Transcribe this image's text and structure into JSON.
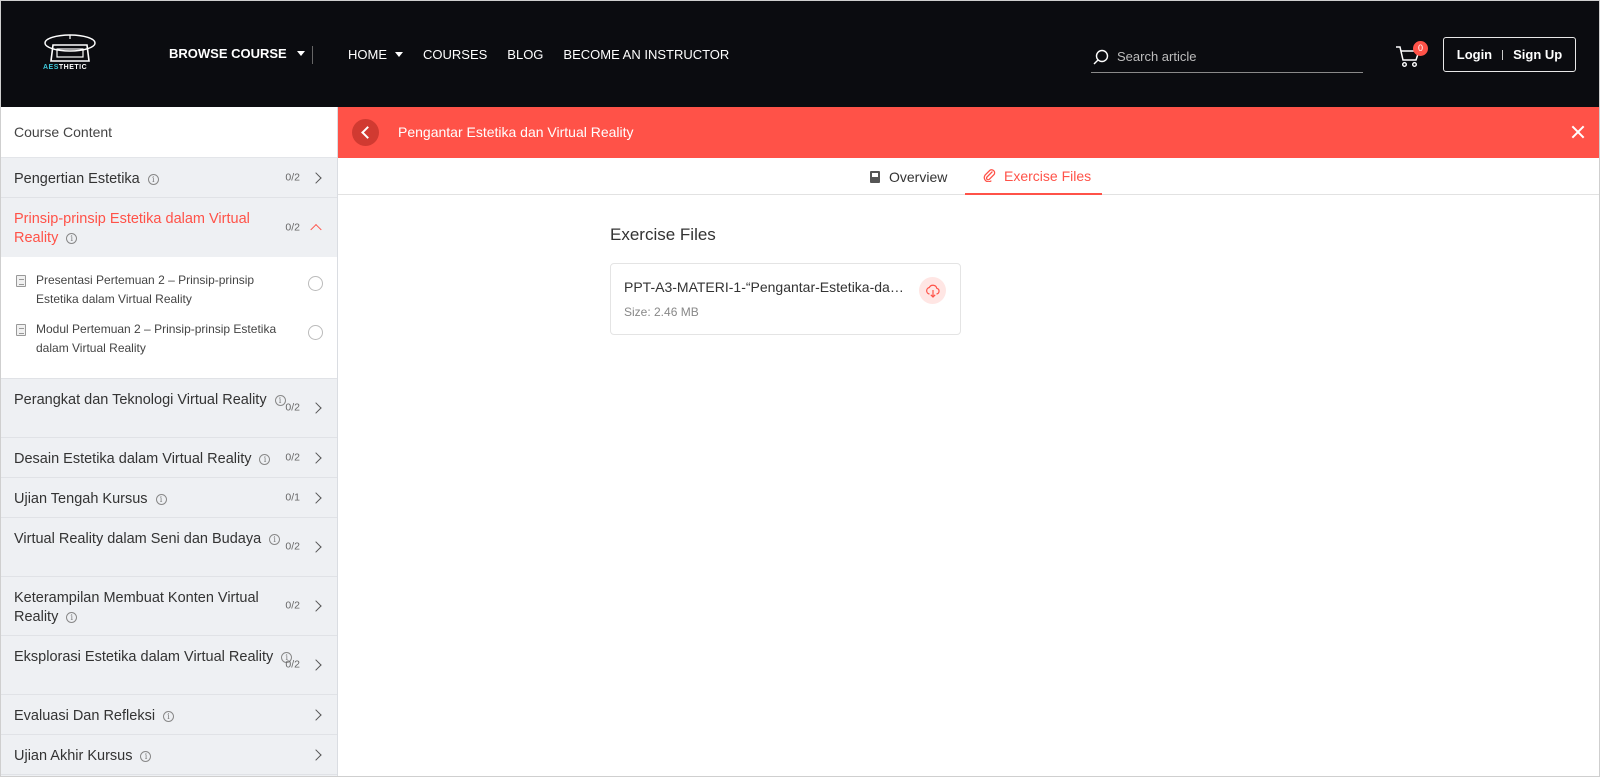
{
  "brand": {
    "name_a": "AES",
    "name_b": "THETIC"
  },
  "nav": {
    "browse_label": "BROWSE COURSE",
    "links": [
      {
        "label": "HOME"
      },
      {
        "label": "COURSES"
      },
      {
        "label": "BLOG"
      },
      {
        "label": "BECOME AN INSTRUCTOR"
      }
    ],
    "search_placeholder": "Search article",
    "cart_count": "0",
    "login_label": "Login",
    "signup_label": "Sign Up"
  },
  "sidebar": {
    "heading": "Course Content",
    "topics": [
      {
        "title": "Pengertian Estetika",
        "count": "0/2"
      },
      {
        "title": "Prinsip-prinsip Estetika dalam Virtual Reality",
        "count": "0/2",
        "expanded": true,
        "lessons": [
          {
            "title": "Presentasi Pertemuan 2 – Prinsip-prinsip Estetika dalam Virtual Reality"
          },
          {
            "title": "Modul Pertemuan 2 – Prinsip-prinsip Estetika dalam Virtual Reality"
          }
        ]
      },
      {
        "title": "Perangkat dan Teknologi Virtual Reality",
        "count": "0/2"
      },
      {
        "title": "Desain Estetika dalam Virtual Reality",
        "count": "0/2"
      },
      {
        "title": "Ujian Tengah Kursus",
        "count": "0/1"
      },
      {
        "title": "Virtual Reality dalam Seni dan Budaya",
        "count": "0/2"
      },
      {
        "title": "Keterampilan Membuat Konten Virtual Reality",
        "count": "0/2"
      },
      {
        "title": "Eksplorasi Estetika dalam Virtual Reality",
        "count": "0/2"
      },
      {
        "title": "Evaluasi Dan Refleksi",
        "count": ""
      },
      {
        "title": "Ujian Akhir Kursus",
        "count": ""
      }
    ]
  },
  "lesson_header": {
    "title": "Pengantar Estetika dan Virtual Reality"
  },
  "tabs": [
    {
      "label": "Overview"
    },
    {
      "label": "Exercise Files",
      "active": true
    }
  ],
  "content": {
    "title": "Exercise Files",
    "file": {
      "name": "PPT-A3-MATERI-1-“Pengantar-Estetika-dan...",
      "size": "Size: 2.46 MB"
    }
  },
  "colors": {
    "accent": "#ff5248",
    "navbar": "#0b0c10",
    "sidebar": "#eef0f3"
  }
}
